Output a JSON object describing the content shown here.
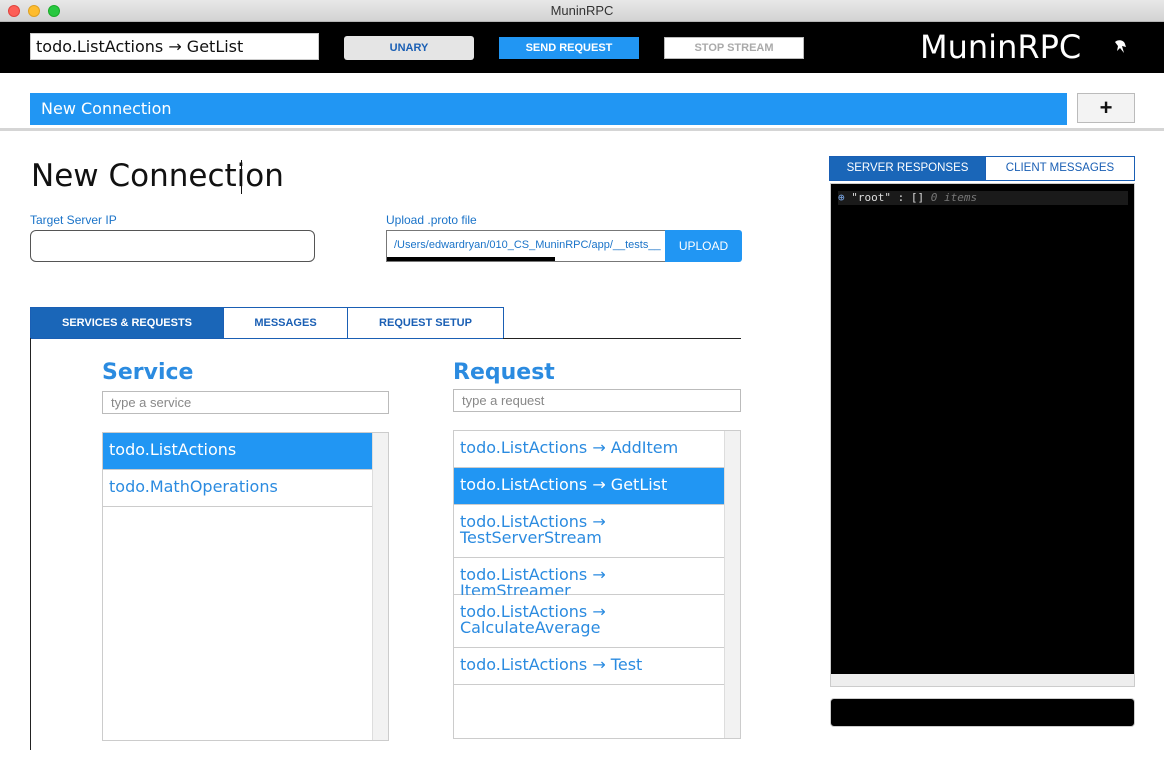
{
  "window": {
    "title": "MuninRPC"
  },
  "toolbar": {
    "route": "todo.ListActions → GetList",
    "unary_label": "UNARY",
    "send_label": "SEND REQUEST",
    "stop_label": "STOP STREAM",
    "brand": "MuninRPC",
    "logo_icon": "raven-logo-icon"
  },
  "connection": {
    "tab_label": "New Connection",
    "add_label": "+"
  },
  "main": {
    "title": "New Connection",
    "target_ip_label": "Target Server IP",
    "target_ip_value": "",
    "upload_label": "Upload .proto file",
    "upload_path": "/Users/edwardryan/010_CS_MuninRPC/app/__tests__",
    "upload_button": "UPLOAD",
    "upload_progress": 0.6
  },
  "tabs": [
    {
      "label": "SERVICES & REQUESTS"
    },
    {
      "label": "MESSAGES"
    },
    {
      "label": "REQUEST SETUP"
    }
  ],
  "services": {
    "heading": "Service",
    "placeholder": "type a service",
    "items": [
      "todo.ListActions",
      "todo.MathOperations"
    ],
    "selected": "todo.ListActions"
  },
  "requests": {
    "heading": "Request",
    "placeholder": "type a request",
    "items": [
      "todo.ListActions → AddItem",
      "todo.ListActions → GetList",
      "todo.ListActions → TestServerStream",
      "todo.ListActions → ItemStreamer",
      "todo.ListActions → CalculateAverage",
      "todo.ListActions → Test"
    ],
    "selected": "todo.ListActions → GetList"
  },
  "response_panel": {
    "tabs": [
      {
        "label": "SERVER RESPONSES"
      },
      {
        "label": "CLIENT MESSAGES"
      }
    ],
    "root_key": "\"root\" : []",
    "root_count": "0 items",
    "expand_icon": "⊕"
  }
}
